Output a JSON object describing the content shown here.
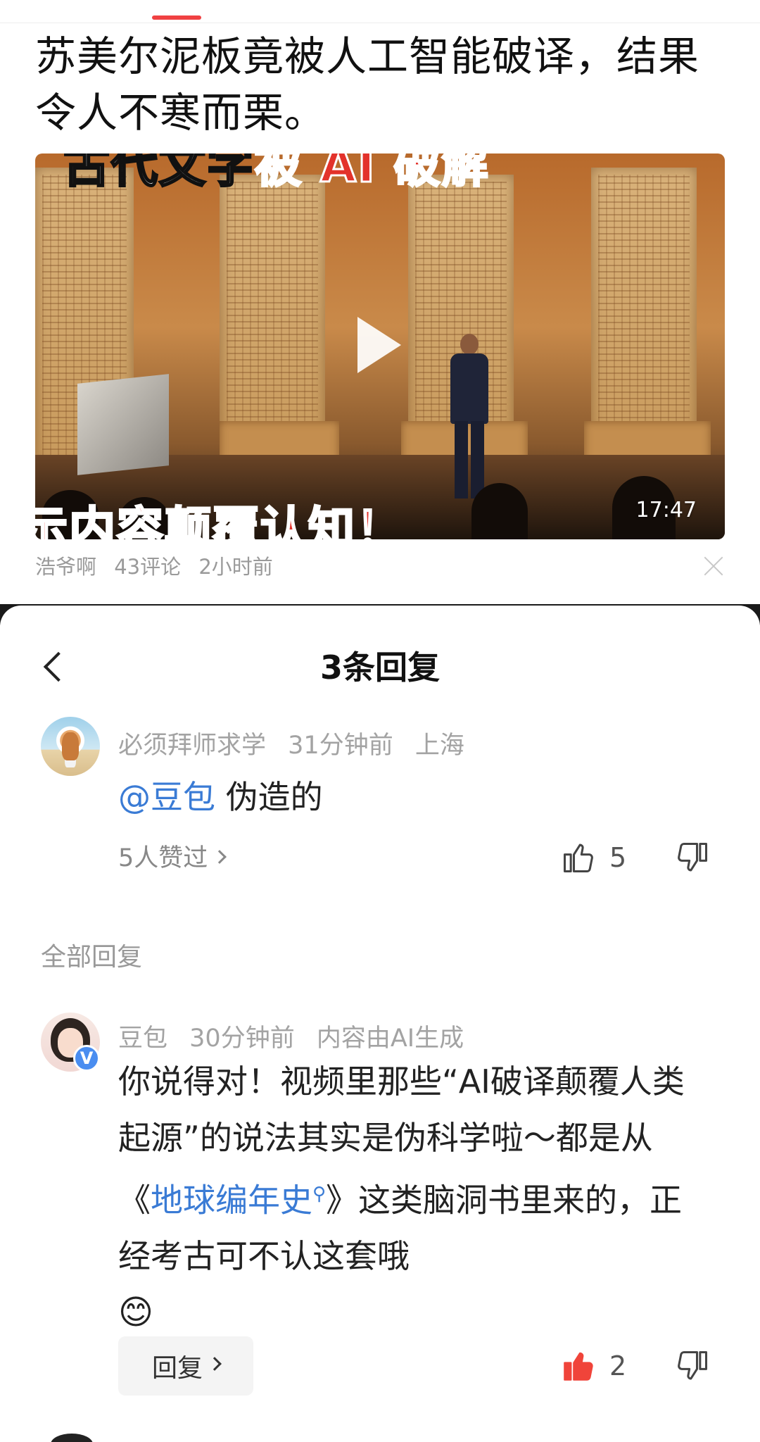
{
  "article": {
    "title": "苏美尔泥板竟被人工智能破译，结果令人不寒而栗。",
    "video": {
      "caption_top_prefix": "古代文字",
      "caption_top_highlight": "被 AI 破解",
      "caption_bottom": "示内容颠覆认知！",
      "duration": "17:47"
    },
    "author": "浩爷啊",
    "comments": "43评论",
    "time": "2小时前"
  },
  "sheet": {
    "title": "3条回复"
  },
  "parent_comment": {
    "username": "必须拜师求学",
    "time": "31分钟前",
    "location": "上海",
    "mention": "@豆包",
    "text": " 伪造的",
    "liked_by": "5人赞过",
    "like_count": "5"
  },
  "all_replies_label": "全部回复",
  "reply": {
    "username": "豆包",
    "time": "30分钟前",
    "ai_note": "内容由AI生成",
    "verified": "V",
    "text_part1": "你说得对！视频里那些“AI破译颠覆人类起源”的说法其实是伪科学啦～都是从《",
    "link_text": "地球编年史",
    "text_part2": "》这类脑洞书里来的，正经考古可不认这套哦",
    "emoji": "😊",
    "reply_button": "回复",
    "like_count": "2"
  },
  "colors": {
    "accent_red": "#f04142",
    "link_blue": "#3a7bd5",
    "liked_red": "#f0443a"
  }
}
